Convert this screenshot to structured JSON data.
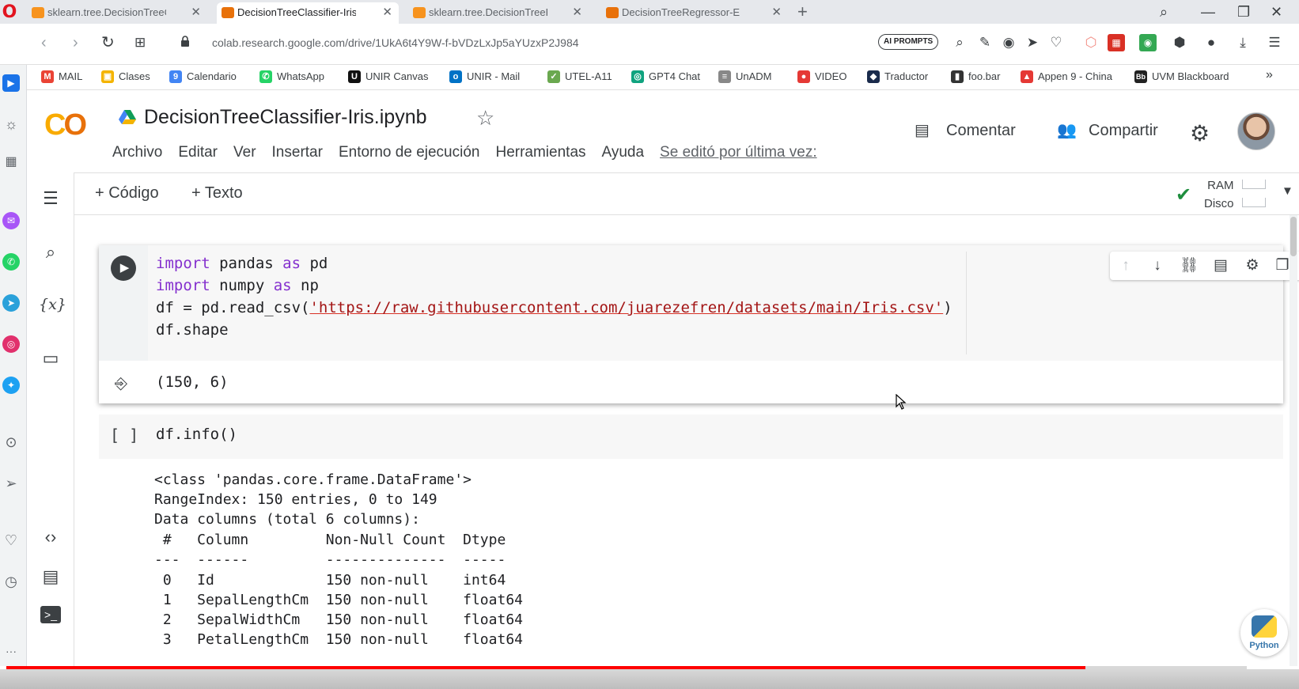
{
  "browser": {
    "tabs": [
      {
        "title": "sklearn.tree.DecisionTreeCl",
        "favicon_color": "#f7931e",
        "favicon": "chart-icon"
      },
      {
        "title": "DecisionTreeClassifier-Iris.ip",
        "favicon_color": "#e8710a",
        "favicon": "colab-icon",
        "active": true
      },
      {
        "title": "sklearn.tree.DecisionTreeRe",
        "favicon_color": "#f7931e",
        "favicon": "chart-icon"
      },
      {
        "title": "DecisionTreeRegressor-Ene",
        "favicon_color": "#e8710a",
        "favicon": "colab-icon"
      }
    ],
    "url": "colab.research.google.com/drive/1UkA6t4Y9W-f-bVDzLxJp5aYUzxP2J984",
    "ai_prompts_label": "AI PROMPTS",
    "bookmarks": [
      {
        "label": "MAIL",
        "color": "#ea4335",
        "glyph": "M"
      },
      {
        "label": "Clases",
        "color": "#f4b400",
        "glyph": "▣"
      },
      {
        "label": "Calendario",
        "color": "#4285f4",
        "glyph": "9"
      },
      {
        "label": "WhatsApp",
        "color": "#25d366",
        "glyph": "✆"
      },
      {
        "label": "UNIR Canvas",
        "color": "#111111",
        "glyph": "U"
      },
      {
        "label": "UNIR - Mail",
        "color": "#0072c6",
        "glyph": "o"
      },
      {
        "label": "UTEL-A11",
        "color": "#6aa84f",
        "glyph": "✓"
      },
      {
        "label": "GPT4 Chat",
        "color": "#10a37f",
        "glyph": "◎"
      },
      {
        "label": "UnADM",
        "color": "#888888",
        "glyph": "≡"
      },
      {
        "label": "VIDEO",
        "color": "#e53935",
        "glyph": "●"
      },
      {
        "label": "Traductor",
        "color": "#1a2b4c",
        "glyph": "◆"
      },
      {
        "label": "foo.bar",
        "color": "#333333",
        "glyph": "▮"
      },
      {
        "label": "Appen 9 - China",
        "color": "#e53935",
        "glyph": "▲"
      },
      {
        "label": "UVM Blackboard",
        "color": "#222222",
        "glyph": "Bb"
      }
    ]
  },
  "colab": {
    "logo": "CO",
    "title": "DecisionTreeClassifier-Iris.ipynb",
    "menu": [
      "Archivo",
      "Editar",
      "Ver",
      "Insertar",
      "Entorno de ejecución",
      "Herramientas",
      "Ayuda"
    ],
    "last_edit": "Se editó por última vez:",
    "comment_label": "Comentar",
    "share_label": "Compartir",
    "toolbar": {
      "code_label": "+ Código",
      "text_label": "+ Texto",
      "ram_label": "RAM",
      "disk_label": "Disco"
    },
    "cells": {
      "cell1_lines": [
        {
          "kw1": "import",
          "rest": " pandas ",
          "kw2": "as",
          "tail": " pd"
        },
        {
          "kw1": "import",
          "rest": " numpy ",
          "kw2": "as",
          "tail": " np"
        }
      ],
      "cell1_line3_pre": "df = pd.read_csv(",
      "cell1_line3_url": "'https://raw.githubusercontent.com/juarezefren/datasets/main/Iris.csv'",
      "cell1_line3_post": ")",
      "cell1_line4": "df.shape",
      "cell1_output": "(150, 6)",
      "cell2_gutter": "[ ]",
      "cell2_code": "df.info()",
      "cell2_output": [
        "<class 'pandas.core.frame.DataFrame'>",
        "RangeIndex: 150 entries, 0 to 149",
        "Data columns (total 6 columns):",
        " #   Column         Non-Null Count  Dtype  ",
        "---  ------         --------------  -----  ",
        " 0   Id             150 non-null    int64  ",
        " 1   SepalLengthCm  150 non-null    float64",
        " 2   SepalWidthCm   150 non-null    float64",
        " 3   PetalLengthCm  150 non-null    float64"
      ]
    }
  },
  "video": {
    "badge_text": "Python",
    "progress_fraction": 0.87
  }
}
